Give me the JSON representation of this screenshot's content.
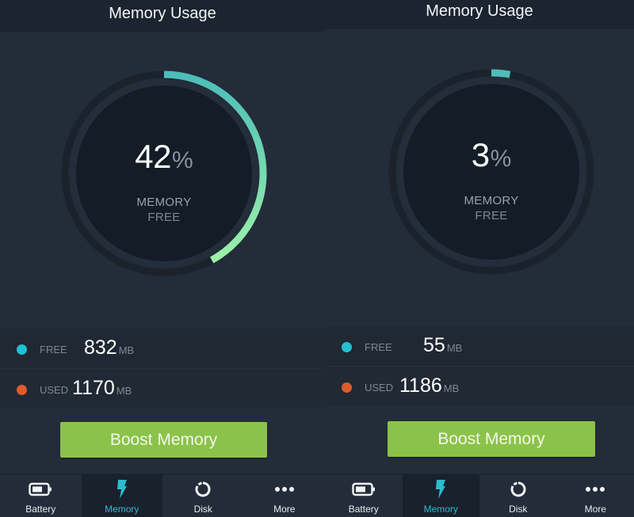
{
  "colors": {
    "accent": "#2bbcd0",
    "free_dot": "#22c0d0",
    "used_dot": "#e05a2b",
    "gauge_start": "#4dbdb9",
    "gauge_end": "#9cf2a8",
    "button": "#8bc34a"
  },
  "screens": [
    {
      "header": {
        "title": "Memory Usage"
      },
      "gauge": {
        "percent_free": 42,
        "value_text": "42",
        "percent_sign": "%",
        "label_line1": "MEMORY",
        "label_line2": "FREE"
      },
      "stats": {
        "free": {
          "label": "FREE",
          "value": "832",
          "unit": "MB"
        },
        "used": {
          "label": "USED",
          "value": "1170",
          "unit": "MB"
        }
      },
      "boost_button": {
        "label": "Boost Memory"
      },
      "nav": [
        {
          "label": "Battery",
          "icon": "battery-icon",
          "active": false
        },
        {
          "label": "Memory",
          "icon": "lightning-bolt-icon",
          "active": true
        },
        {
          "label": "Disk",
          "icon": "disk-circle-icon",
          "active": false
        },
        {
          "label": "More",
          "icon": "more-dots-icon",
          "active": false
        }
      ]
    },
    {
      "header": {
        "title": "Memory Usage"
      },
      "gauge": {
        "percent_free": 3,
        "value_text": "3",
        "percent_sign": "%",
        "label_line1": "MEMORY",
        "label_line2": "FREE"
      },
      "stats": {
        "free": {
          "label": "FREE",
          "value": "55",
          "unit": "MB"
        },
        "used": {
          "label": "USED",
          "value": "1186",
          "unit": "MB"
        }
      },
      "boost_button": {
        "label": "Boost Memory"
      },
      "nav": [
        {
          "label": "Battery",
          "icon": "battery-icon",
          "active": false
        },
        {
          "label": "Memory",
          "icon": "lightning-bolt-icon",
          "active": true
        },
        {
          "label": "Disk",
          "icon": "disk-circle-icon",
          "active": false
        },
        {
          "label": "More",
          "icon": "more-dots-icon",
          "active": false
        }
      ]
    }
  ]
}
